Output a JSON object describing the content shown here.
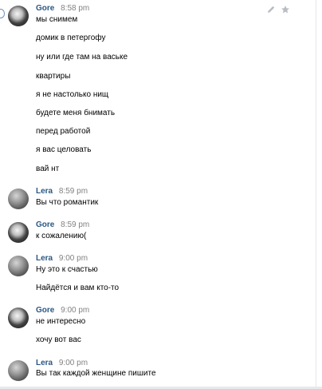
{
  "messages": [
    {
      "author": "Gore",
      "time": "8:58 pm",
      "lines": [
        "мы снимем",
        "домик в петергофу",
        "ну или где там на ваське",
        "квартиры",
        "я не настолько нищ",
        "будете меня бнимать",
        "перед работой",
        "я вас целовать",
        "вай нт"
      ]
    },
    {
      "author": "Lera",
      "time": "8:59 pm",
      "lines": [
        "Вы что романтик"
      ]
    },
    {
      "author": "Gore",
      "time": "8:59 pm",
      "lines": [
        "к сожалению("
      ]
    },
    {
      "author": "Lera",
      "time": "9:00 pm",
      "lines": [
        "Ну это к счастью",
        "Найдётся и вам кто-то"
      ]
    },
    {
      "author": "Gore",
      "time": "9:00 pm",
      "lines": [
        "не интересно",
        "хочу вот вас"
      ]
    },
    {
      "author": "Lera",
      "time": "9:00 pm",
      "lines": [
        "Вы так каждой женщине пишите"
      ]
    }
  ],
  "toolbar": {
    "edit_icon": "pencil-icon",
    "star_icon": "star-icon"
  },
  "colors": {
    "author": "#2a5885",
    "time": "#828282",
    "text": "#000000",
    "divider": "#e7e8ec"
  }
}
